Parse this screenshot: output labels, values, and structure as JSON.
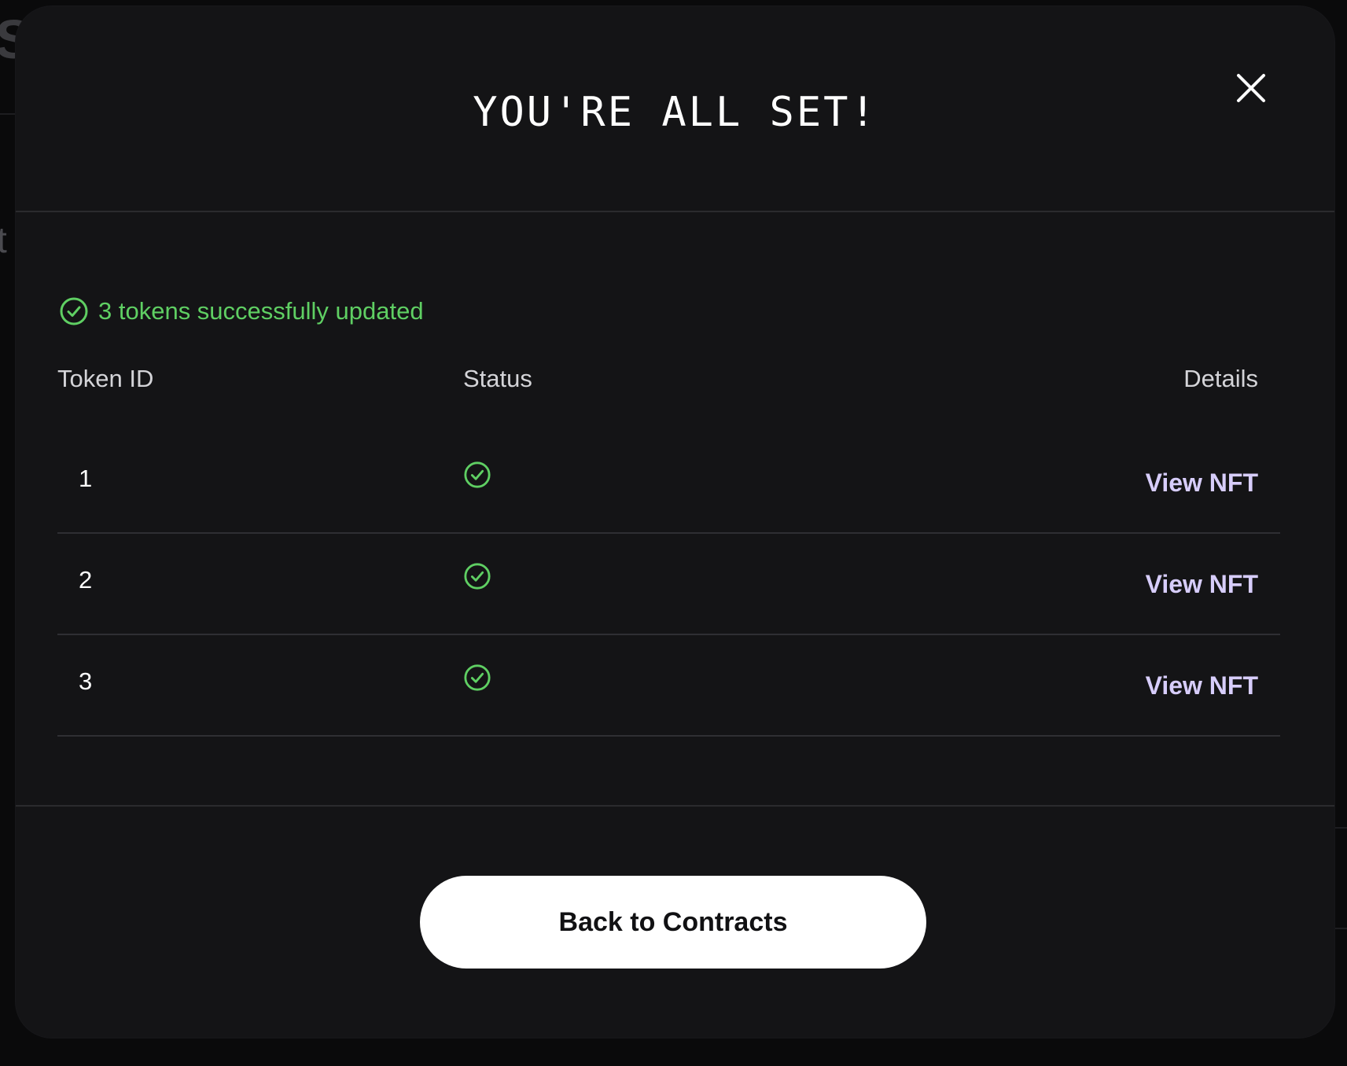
{
  "modal": {
    "title": "YOU'RE ALL SET!",
    "close_icon": "close-icon"
  },
  "summary": {
    "icon": "check-circle-icon",
    "text": "3 tokens successfully updated",
    "color": "#5fcf63"
  },
  "table": {
    "headers": {
      "token_id": "Token ID",
      "status": "Status",
      "details": "Details"
    },
    "rows": [
      {
        "token_id": "1",
        "status_icon": "check-circle-icon",
        "link": "View NFT"
      },
      {
        "token_id": "2",
        "status_icon": "check-circle-icon",
        "link": "View NFT"
      },
      {
        "token_id": "3",
        "status_icon": "check-circle-icon",
        "link": "View NFT"
      }
    ]
  },
  "footer": {
    "button_label": "Back to Contracts"
  },
  "colors": {
    "modal_bg": "#141416",
    "success": "#5fcf63",
    "link": "#d7cdfb",
    "button_bg": "#ffffff"
  }
}
